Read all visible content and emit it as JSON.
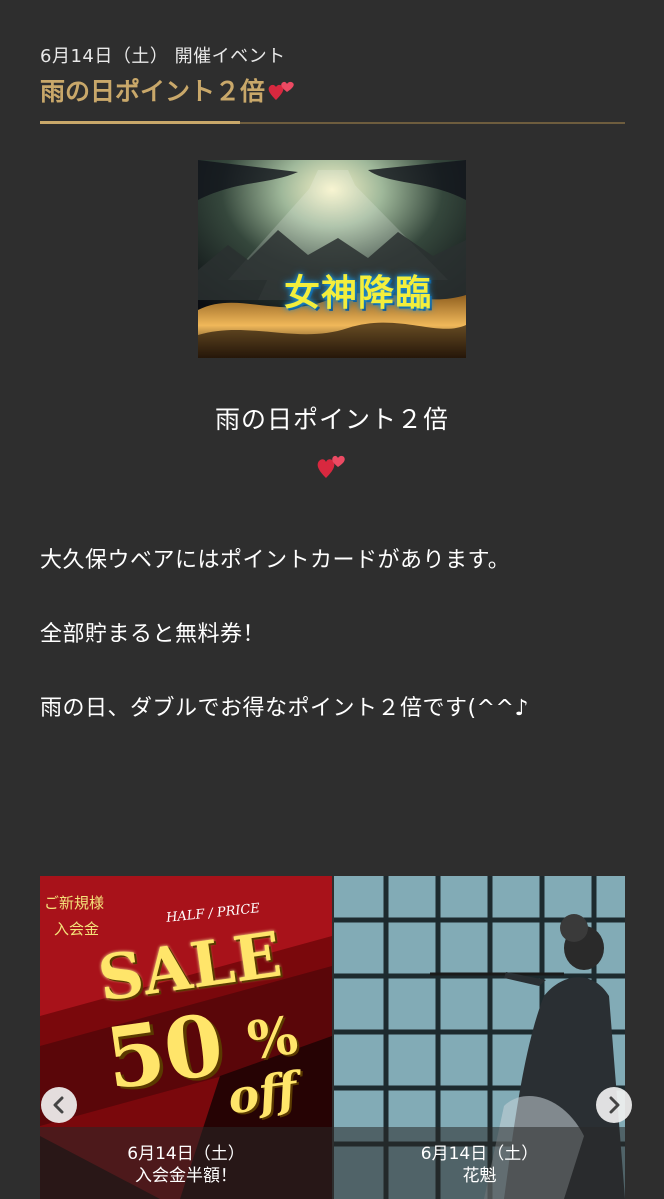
{
  "event": {
    "date_line": "6月14日（土） 開催イベント",
    "title": "雨の日ポイント２倍"
  },
  "banner": {
    "text": "女神降臨"
  },
  "content": {
    "subtitle": "雨の日ポイント２倍",
    "paragraphs": [
      "大久保ウベアにはポイントカードがあります。",
      "全部貯まると無料券！",
      "雨の日、ダブルでお得なポイント２倍です(^^♪"
    ]
  },
  "carousel": {
    "cards": [
      {
        "image_text": {
          "corner": "ご新規様",
          "corner2": "入会金",
          "half_price": "HALF / PRICE",
          "sale": "SALE",
          "percent": "50",
          "pct_sign": "%",
          "off": "off"
        },
        "date": "6月14日（土）",
        "label": "入会金半額！"
      },
      {
        "date": "6月14日（土）",
        "label": "花魁"
      }
    ]
  },
  "colors": {
    "background": "#2e2e2e",
    "gold": "#c9a86a",
    "heart": "#e0314e"
  }
}
